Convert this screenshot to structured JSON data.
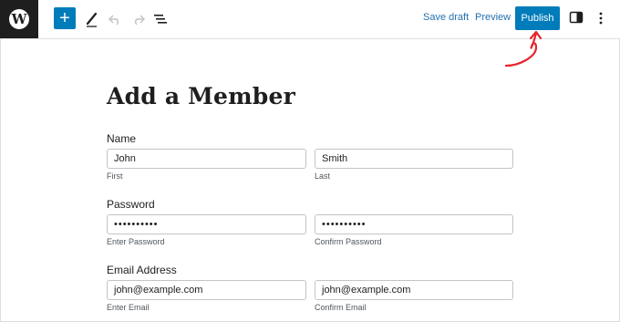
{
  "toolbar": {
    "save_draft_label": "Save draft",
    "preview_label": "Preview",
    "publish_label": "Publish"
  },
  "page": {
    "title": "Add a Member"
  },
  "form": {
    "name": {
      "label": "Name",
      "first_value": "John",
      "first_sub": "First",
      "last_value": "Smith",
      "last_sub": "Last"
    },
    "password": {
      "label": "Password",
      "enter_value": "••••••••••",
      "enter_sub": "Enter Password",
      "confirm_value": "••••••••••",
      "confirm_sub": "Confirm Password"
    },
    "email": {
      "label": "Email Address",
      "enter_value": "john@example.com",
      "enter_sub": "Enter Email",
      "confirm_value": "john@example.com",
      "confirm_sub": "Confirm Email"
    }
  },
  "colors": {
    "accent": "#007cba",
    "annotation": "#e4262c"
  },
  "icons": [
    "wordpress-icon",
    "plus-icon",
    "pen-icon",
    "undo-icon",
    "redo-icon",
    "list-view-icon",
    "sidebar-icon",
    "more-options-icon",
    "arrow-annotation-icon"
  ]
}
